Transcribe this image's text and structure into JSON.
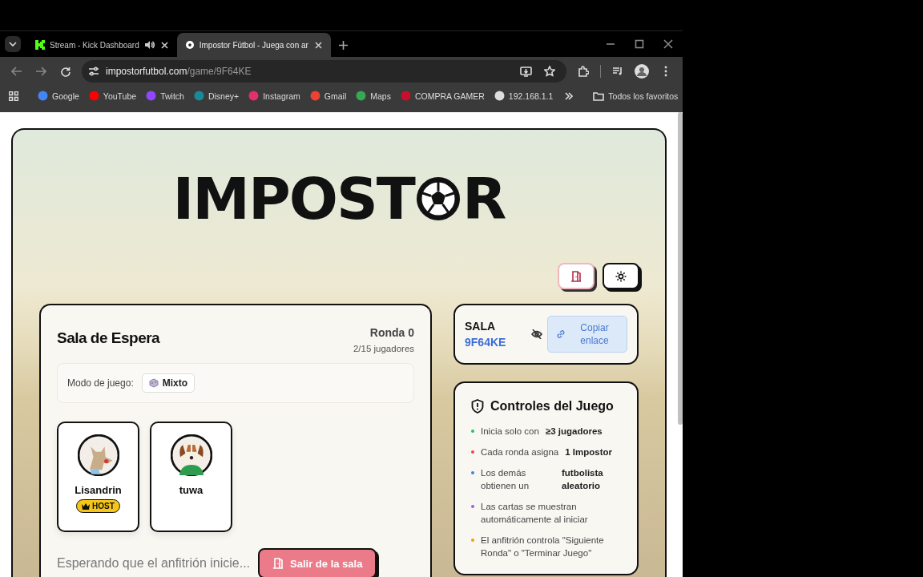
{
  "browser": {
    "tabs": [
      {
        "title": "Stream - Kick Dashboard",
        "selected": false,
        "audio": true
      },
      {
        "title": "Impostor Fútbol - Juega con ar",
        "selected": true,
        "audio": false
      }
    ],
    "url_host": "impostorfutbol.com",
    "url_path": "/game/9F64KE",
    "bookmarks": [
      "Google",
      "YouTube",
      "Twitch",
      "Disney+",
      "Instagram",
      "Gmail",
      "Maps",
      "COMPRA GAMER",
      "192.168.1.1"
    ],
    "all_bookmarks": "Todos los favoritos"
  },
  "logo": {
    "before": "IMPOST",
    "after": "R"
  },
  "lobby": {
    "title": "Sala de Espera",
    "round": "Ronda 0",
    "players_count": "2/15 jugadores",
    "mode_label": "Modo de juego:",
    "mode": "Mixto",
    "players": [
      {
        "name": "Lisandrin",
        "host": true,
        "badge": "HOST"
      },
      {
        "name": "tuwa",
        "host": false
      }
    ],
    "waiting": "Esperando que el anfitrión inicie...",
    "leave": "Salir de la sala"
  },
  "room": {
    "label": "SALA",
    "code": "9F64KE",
    "copy": "Copiar enlace"
  },
  "controls": {
    "title": "Controles del Juego",
    "rules": [
      {
        "text": "Inicia solo con",
        "strong": "≥3 jugadores",
        "color": "#22c55e"
      },
      {
        "text": "Cada ronda asigna",
        "strong": "1 Impostor",
        "color": "#ef4444"
      },
      {
        "text": "Los demás obtienen un",
        "strong": "futbolista aleatorio",
        "color": "#3b82f6"
      },
      {
        "text": "Las cartas se muestran automáticamente al iniciar",
        "color": "#a855f7"
      },
      {
        "text": "El anfitrión controla \"Siguiente Ronda\" o \"Terminar Juego\"",
        "color": "#f59e0b"
      }
    ]
  }
}
